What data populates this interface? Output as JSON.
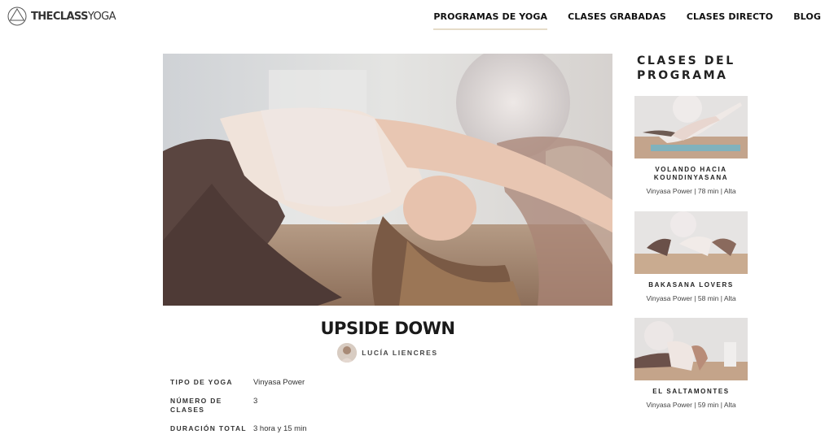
{
  "header": {
    "logo": {
      "bold": "THECLASS",
      "light": "YOGA"
    },
    "nav": [
      {
        "label": "PROGRAMAS DE YOGA",
        "active": true
      },
      {
        "label": "CLASES GRABADAS",
        "active": false
      },
      {
        "label": "CLASES DIRECTO",
        "active": false
      },
      {
        "label": "BLOG",
        "active": false
      }
    ]
  },
  "program": {
    "title": "UPSIDE DOWN",
    "author": "LUCÍA LIENCRES",
    "details": [
      {
        "label": "TIPO DE YOGA",
        "value": "Vinyasa Power"
      },
      {
        "label": "NÚMERO DE CLASES",
        "value": "3"
      },
      {
        "label": "DURACIÓN TOTAL",
        "value": "3 hora y 15 min"
      }
    ]
  },
  "sidebar": {
    "title_line1": "CLASES DEL",
    "title_line2": "PROGRAMA",
    "classes": [
      {
        "title": "VOLANDO HACIA KOUNDINYASANA",
        "meta": "Vinyasa Power | 78 min | Alta"
      },
      {
        "title": "BAKASANA LOVERS",
        "meta": "Vinyasa Power | 58 min | Alta"
      },
      {
        "title": "EL SALTAMONTES",
        "meta": "Vinyasa Power | 59 min | Alta"
      }
    ]
  },
  "colors": {
    "accent": "#e6dcc8",
    "text": "#1a1a1a"
  }
}
